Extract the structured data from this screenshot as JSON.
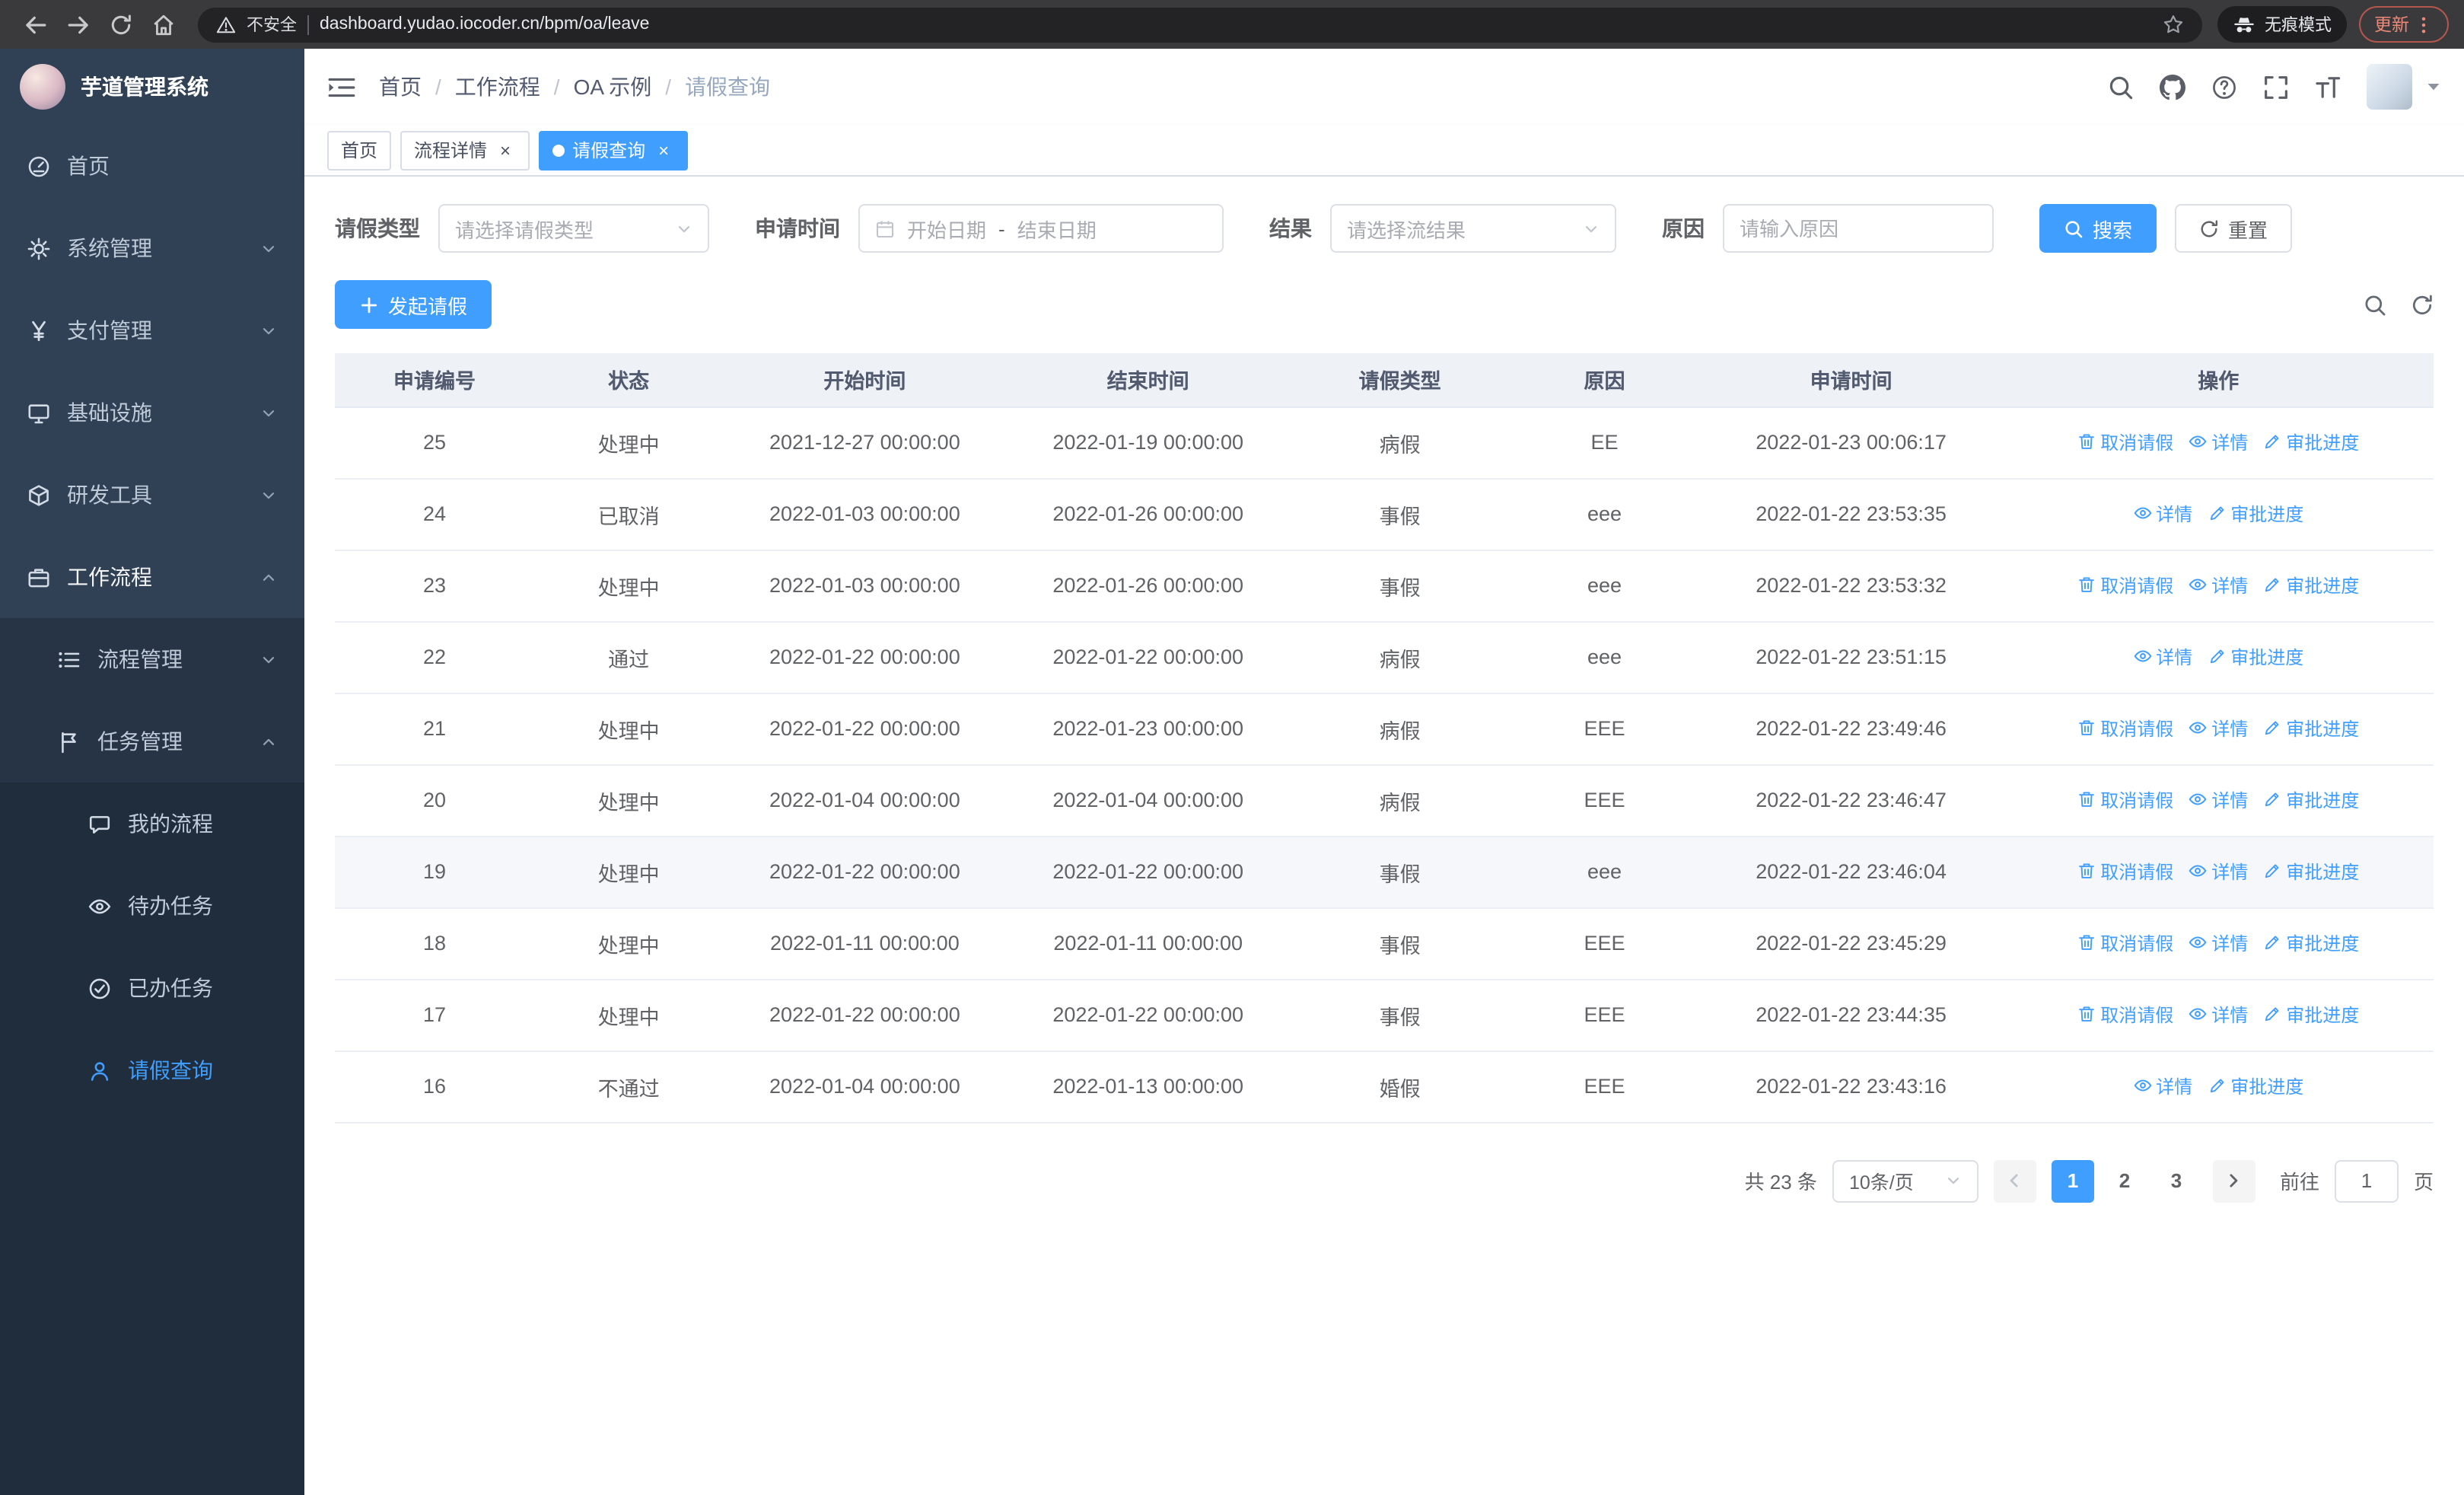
{
  "browser": {
    "security_label": "不安全",
    "url": "dashboard.yudao.iocoder.cn/bpm/oa/leave",
    "incognito_label": "无痕模式",
    "update_label": "更新"
  },
  "sidebar": {
    "app_title": "芋道管理系统",
    "menu": [
      {
        "key": "home",
        "label": "首页",
        "icon": "dashboard-icon",
        "level": 1
      },
      {
        "key": "system",
        "label": "系统管理",
        "icon": "gear-icon",
        "level": 1,
        "chevron": "down"
      },
      {
        "key": "payment",
        "label": "支付管理",
        "icon": "yen-icon",
        "level": 1,
        "chevron": "down"
      },
      {
        "key": "infrastructure",
        "label": "基础设施",
        "icon": "monitor-icon",
        "level": 1,
        "chevron": "down"
      },
      {
        "key": "devtools",
        "label": "研发工具",
        "icon": "cube-icon",
        "level": 1,
        "chevron": "down"
      },
      {
        "key": "workflow",
        "label": "工作流程",
        "icon": "briefcase-icon",
        "level": 1,
        "chevron": "up",
        "active_parent": true
      },
      {
        "key": "process-management",
        "label": "流程管理",
        "icon": "list-icon",
        "level": 2,
        "chevron": "down"
      },
      {
        "key": "task-management",
        "label": "任务管理",
        "icon": "flag-icon",
        "level": 2,
        "chevron": "up"
      },
      {
        "key": "my-process",
        "label": "我的流程",
        "icon": "chat-icon",
        "level": 3
      },
      {
        "key": "todo-tasks",
        "label": "待办任务",
        "icon": "eye-icon",
        "level": 3
      },
      {
        "key": "done-tasks",
        "label": "已办任务",
        "icon": "check-icon",
        "level": 3
      },
      {
        "key": "leave-query",
        "label": "请假查询",
        "icon": "user-icon",
        "level": 3,
        "active": true
      }
    ]
  },
  "header": {
    "breadcrumb": [
      "首页",
      "工作流程",
      "OA 示例",
      "请假查询"
    ]
  },
  "tabs": [
    {
      "key": "home",
      "label": "首页",
      "closable": false,
      "active": false
    },
    {
      "key": "process-detail",
      "label": "流程详情",
      "closable": true,
      "active": false
    },
    {
      "key": "leave-query",
      "label": "请假查询",
      "closable": true,
      "active": true
    }
  ],
  "filters": {
    "leave_type_label": "请假类型",
    "leave_type_placeholder": "请选择请假类型",
    "apply_time_label": "申请时间",
    "start_date_placeholder": "开始日期",
    "date_separator": "-",
    "end_date_placeholder": "结束日期",
    "result_label": "结果",
    "result_placeholder": "请选择流结果",
    "reason_label": "原因",
    "reason_placeholder": "请输入原因",
    "search_label": "搜索",
    "reset_label": "重置"
  },
  "toolbar": {
    "create_label": "发起请假"
  },
  "table": {
    "columns": [
      "申请编号",
      "状态",
      "开始时间",
      "结束时间",
      "请假类型",
      "原因",
      "申请时间",
      "操作"
    ],
    "action_labels": {
      "cancel": "取消请假",
      "detail": "详情",
      "progress": "审批进度"
    },
    "rows": [
      {
        "id": "25",
        "status": "处理中",
        "start_time": "2021-12-27 00:00:00",
        "end_time": "2022-01-19 00:00:00",
        "leave_type": "病假",
        "reason": "EE",
        "apply_time": "2022-01-23 00:06:17",
        "actions": [
          "cancel",
          "detail",
          "progress"
        ]
      },
      {
        "id": "24",
        "status": "已取消",
        "start_time": "2022-01-03 00:00:00",
        "end_time": "2022-01-26 00:00:00",
        "leave_type": "事假",
        "reason": "eee",
        "apply_time": "2022-01-22 23:53:35",
        "actions": [
          "detail",
          "progress"
        ]
      },
      {
        "id": "23",
        "status": "处理中",
        "start_time": "2022-01-03 00:00:00",
        "end_time": "2022-01-26 00:00:00",
        "leave_type": "事假",
        "reason": "eee",
        "apply_time": "2022-01-22 23:53:32",
        "actions": [
          "cancel",
          "detail",
          "progress"
        ]
      },
      {
        "id": "22",
        "status": "通过",
        "start_time": "2022-01-22 00:00:00",
        "end_time": "2022-01-22 00:00:00",
        "leave_type": "病假",
        "reason": "eee",
        "apply_time": "2022-01-22 23:51:15",
        "actions": [
          "detail",
          "progress"
        ]
      },
      {
        "id": "21",
        "status": "处理中",
        "start_time": "2022-01-22 00:00:00",
        "end_time": "2022-01-23 00:00:00",
        "leave_type": "病假",
        "reason": "EEE",
        "apply_time": "2022-01-22 23:49:46",
        "actions": [
          "cancel",
          "detail",
          "progress"
        ]
      },
      {
        "id": "20",
        "status": "处理中",
        "start_time": "2022-01-04 00:00:00",
        "end_time": "2022-01-04 00:00:00",
        "leave_type": "病假",
        "reason": "EEE",
        "apply_time": "2022-01-22 23:46:47",
        "actions": [
          "cancel",
          "detail",
          "progress"
        ]
      },
      {
        "id": "19",
        "status": "处理中",
        "start_time": "2022-01-22 00:00:00",
        "end_time": "2022-01-22 00:00:00",
        "leave_type": "事假",
        "reason": "eee",
        "apply_time": "2022-01-22 23:46:04",
        "actions": [
          "cancel",
          "detail",
          "progress"
        ],
        "hover": true
      },
      {
        "id": "18",
        "status": "处理中",
        "start_time": "2022-01-11 00:00:00",
        "end_time": "2022-01-11 00:00:00",
        "leave_type": "事假",
        "reason": "EEE",
        "apply_time": "2022-01-22 23:45:29",
        "actions": [
          "cancel",
          "detail",
          "progress"
        ]
      },
      {
        "id": "17",
        "status": "处理中",
        "start_time": "2022-01-22 00:00:00",
        "end_time": "2022-01-22 00:00:00",
        "leave_type": "事假",
        "reason": "EEE",
        "apply_time": "2022-01-22 23:44:35",
        "actions": [
          "cancel",
          "detail",
          "progress"
        ]
      },
      {
        "id": "16",
        "status": "不通过",
        "start_time": "2022-01-04 00:00:00",
        "end_time": "2022-01-13 00:00:00",
        "leave_type": "婚假",
        "reason": "EEE",
        "apply_time": "2022-01-22 23:43:16",
        "actions": [
          "detail",
          "progress"
        ]
      }
    ]
  },
  "pagination": {
    "total_text": "共 23 条",
    "page_size": "10条/页",
    "pages": [
      "1",
      "2",
      "3"
    ],
    "current_page": "1",
    "goto_label": "前往",
    "goto_value": "1",
    "page_suffix": "页"
  }
}
